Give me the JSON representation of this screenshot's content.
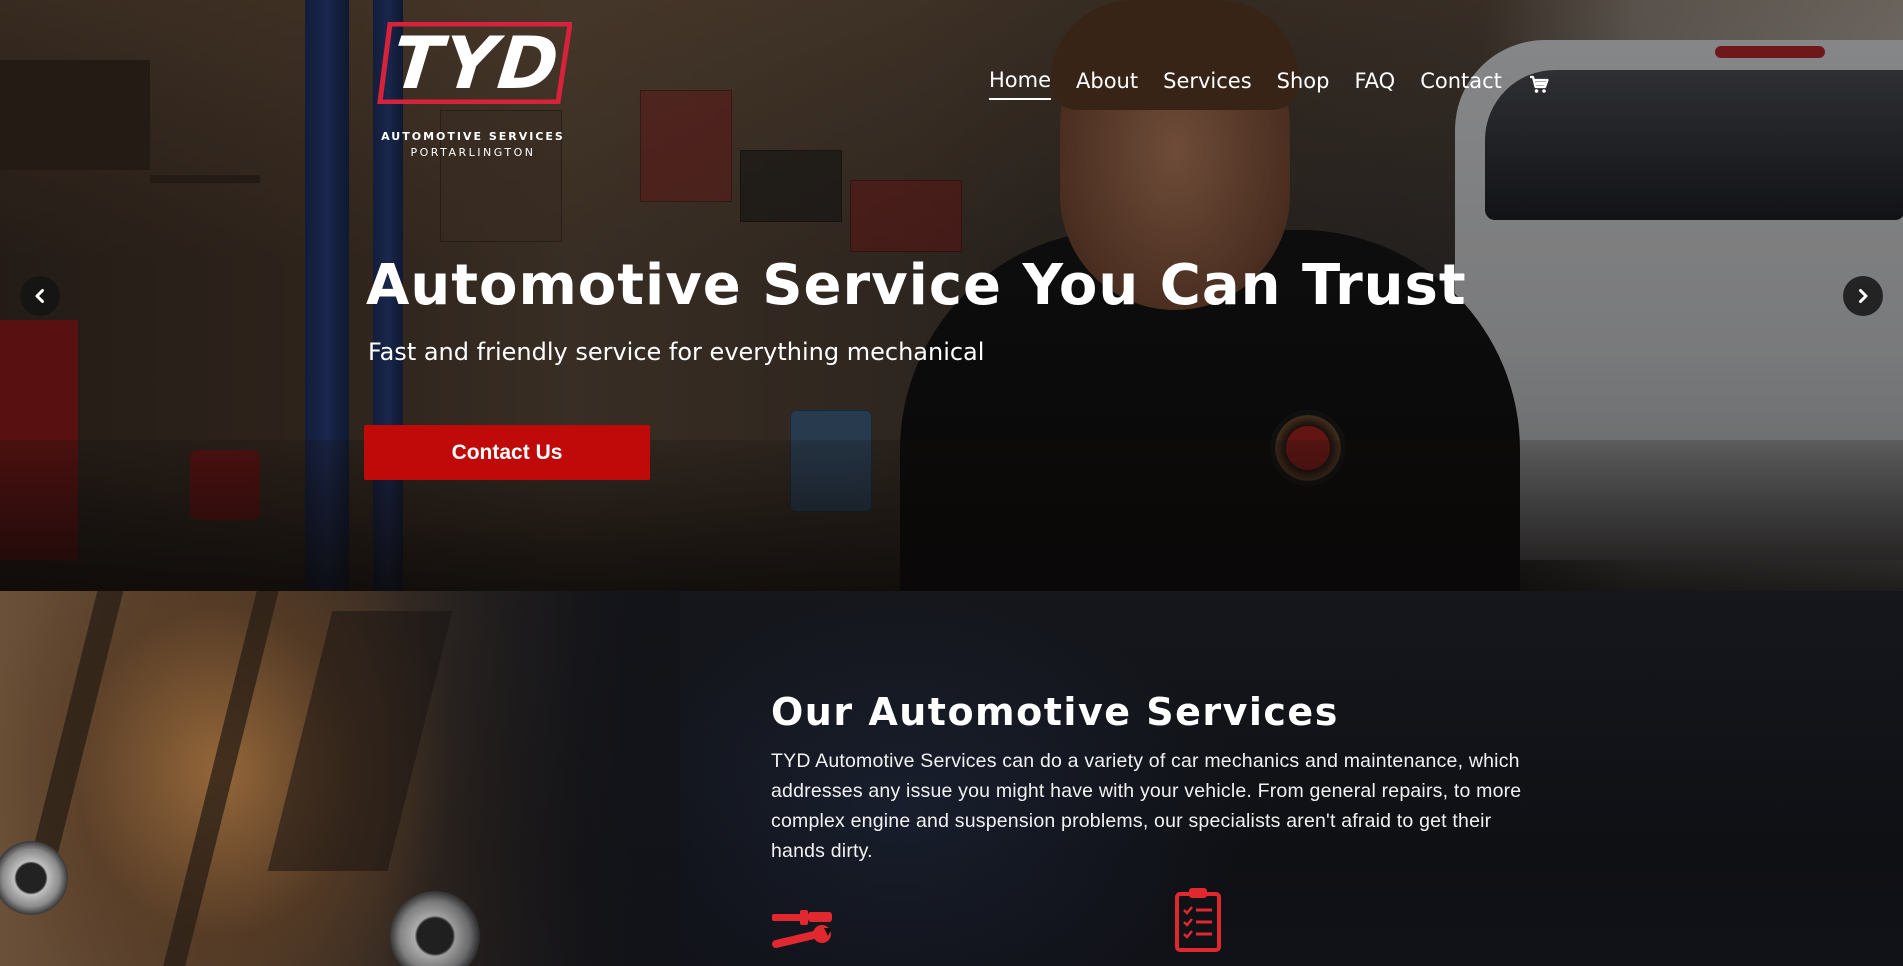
{
  "brand": {
    "name": "TYD",
    "line1": "AUTOMOTIVE SERVICES",
    "line2": "PORTARLINGTON",
    "accent": "#c00a0a"
  },
  "nav": {
    "items": [
      {
        "label": "Home",
        "active": true
      },
      {
        "label": "About",
        "active": false
      },
      {
        "label": "Services",
        "active": false
      },
      {
        "label": "Shop",
        "active": false
      },
      {
        "label": "FAQ",
        "active": false
      },
      {
        "label": "Contact",
        "active": false
      }
    ],
    "cart_icon": "cart-icon"
  },
  "hero": {
    "title": "Automotive Service You Can Trust",
    "subtitle": "Fast and friendly service for everything mechanical",
    "cta_label": "Contact Us",
    "prev_icon": "chevron-left-icon",
    "next_icon": "chevron-right-icon"
  },
  "services": {
    "title": "Our Automotive Services",
    "text": "TYD Automotive Services can do a variety of car mechanics and maintenance, which addresses any issue you might have with your vehicle. From general repairs, to more complex engine and suspension problems, our specialists aren't afraid to get their hands dirty.",
    "icons": [
      "tools-icon",
      "clipboard-checklist-icon"
    ]
  }
}
